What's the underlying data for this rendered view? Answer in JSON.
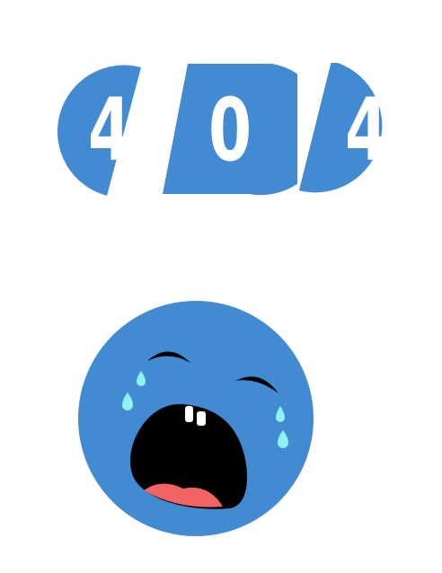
{
  "error_code": {
    "digits": [
      "4",
      "0",
      "4"
    ]
  },
  "colors": {
    "accent": "#428BD3",
    "digit_text": "#FFFFFF",
    "tears": "#8FF2F2",
    "mouth": "#000000",
    "tongue": "#F26464",
    "teeth": "#FFFFFF",
    "eyebrows": "#000000"
  },
  "illustration": {
    "icon": "crying-face-icon"
  }
}
